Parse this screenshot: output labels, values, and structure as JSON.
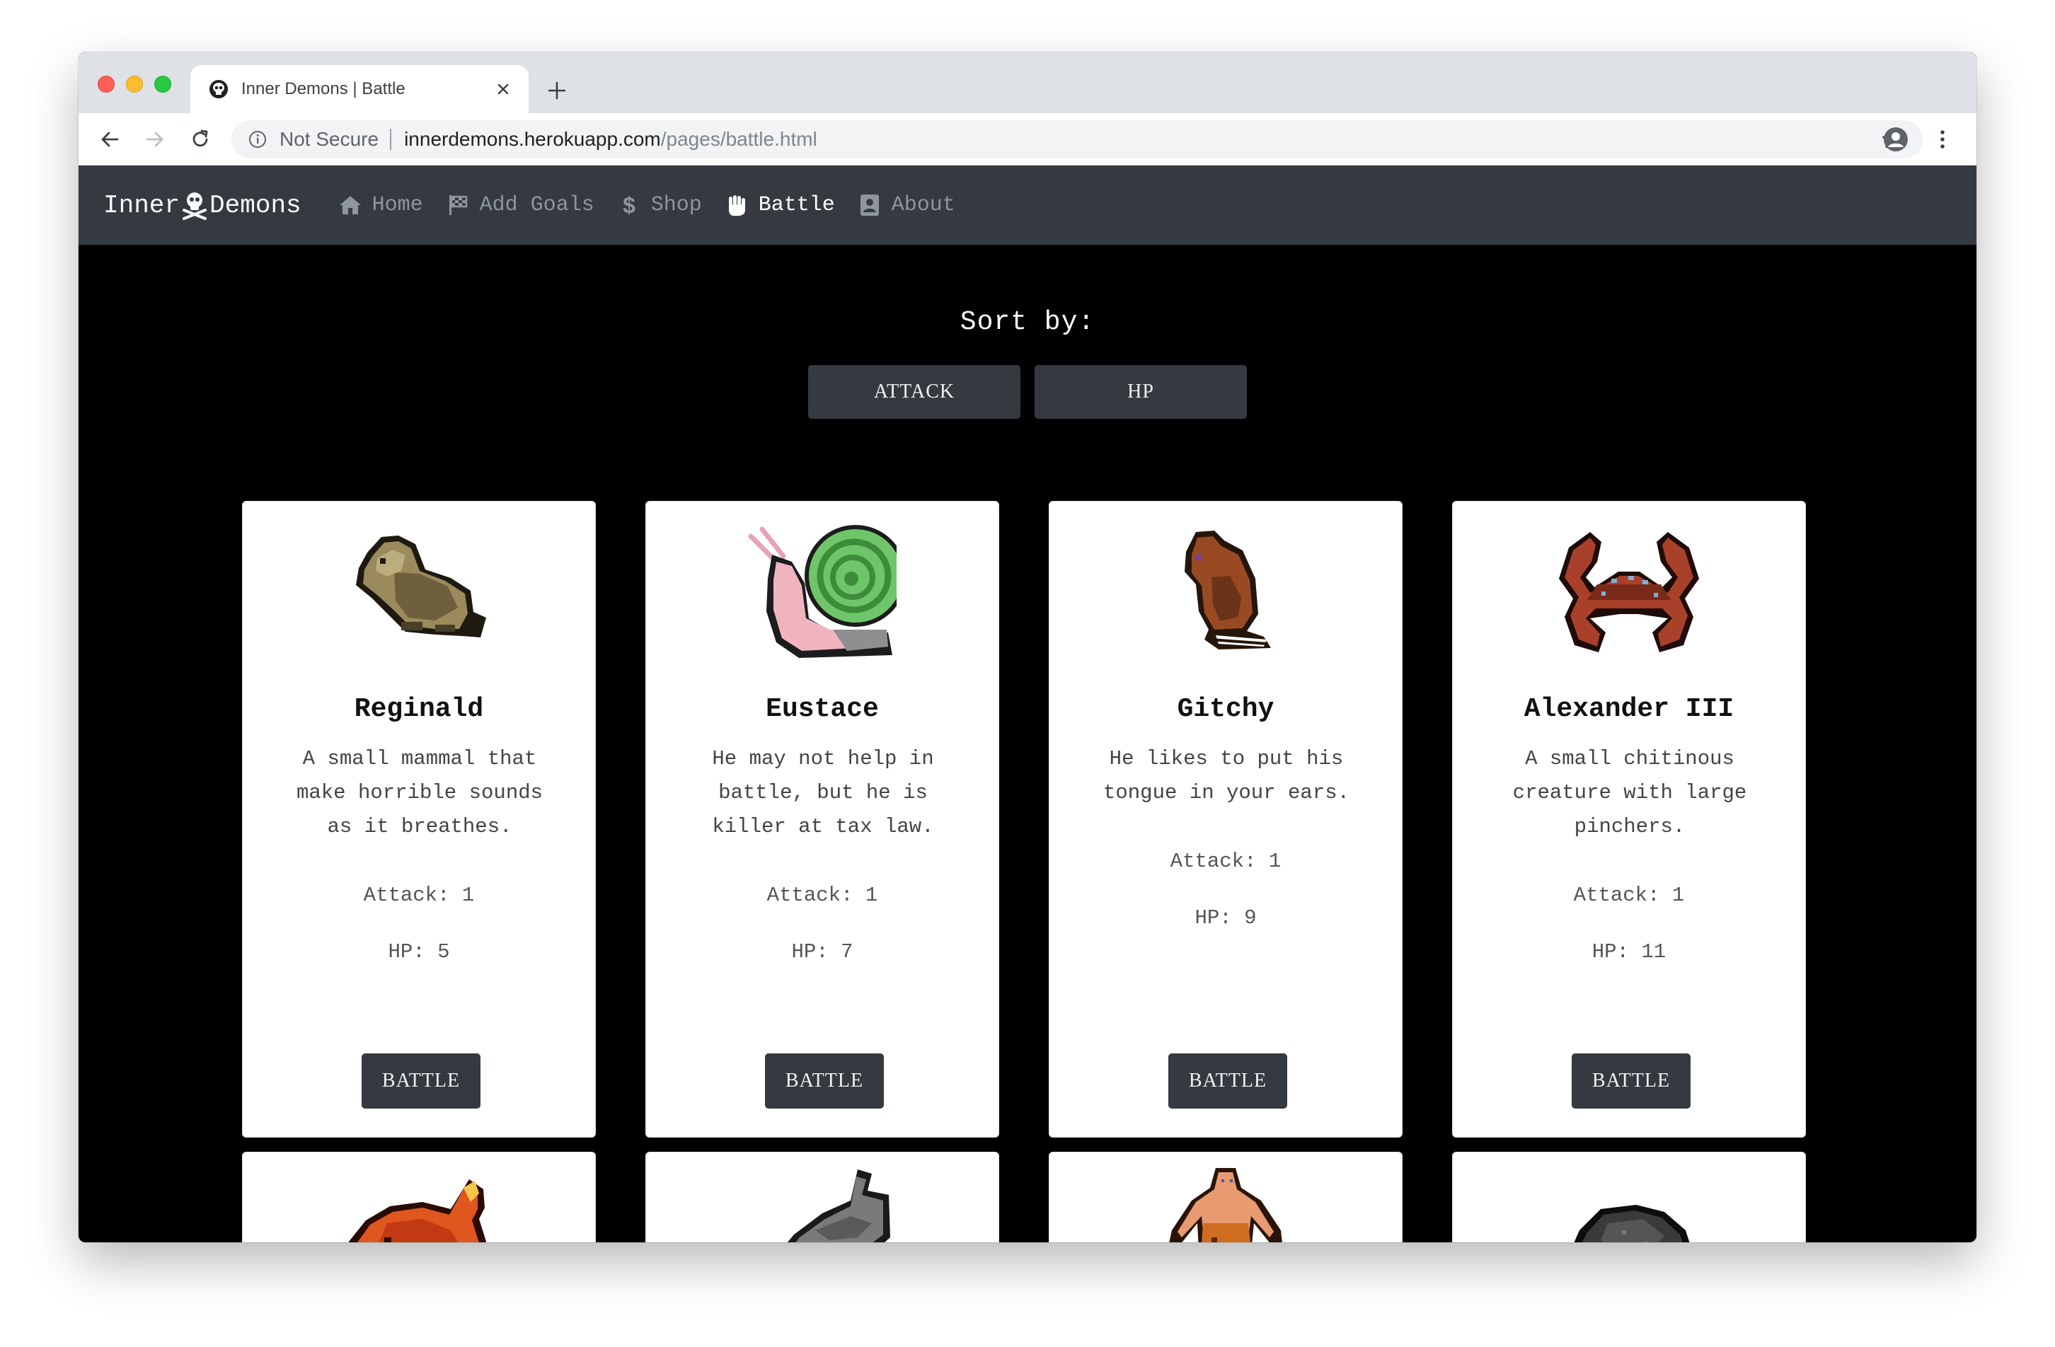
{
  "browser": {
    "tab_title": "Inner Demons | Battle",
    "security_label": "Not Secure",
    "url_host": "innerdemons.herokuapp.com",
    "url_path": "/pages/battle.html"
  },
  "site": {
    "brand_left": "Inner",
    "brand_right": "Demons",
    "nav": [
      {
        "label": "Home",
        "icon": "home-icon"
      },
      {
        "label": "Add Goals",
        "icon": "flag-icon"
      },
      {
        "label": "Shop",
        "icon": "dollar-icon"
      },
      {
        "label": "Battle",
        "icon": "fist-icon",
        "active": true
      },
      {
        "label": "About",
        "icon": "id-badge-icon"
      }
    ]
  },
  "sort": {
    "label": "Sort by:",
    "buttons": [
      "ATTACK",
      "HP"
    ]
  },
  "cards": [
    {
      "name": "Reginald",
      "description": "A small mammal that make horrible sounds as it breathes.",
      "attack": "Attack: 1",
      "hp": "HP: 5",
      "button": "BATTLE",
      "sprite": "gopher-sprite"
    },
    {
      "name": "Eustace",
      "description": "He may not help in battle, but he is killer at tax law.",
      "attack": "Attack: 1",
      "hp": "HP: 7",
      "button": "BATTLE",
      "sprite": "snail-sprite"
    },
    {
      "name": "Gitchy",
      "description": "He likes to put his tongue in your ears.",
      "attack": "Attack: 1",
      "hp": "HP: 9",
      "button": "BATTLE",
      "sprite": "rat-sprite"
    },
    {
      "name": "Alexander III",
      "description": "A small chitinous creature with large pinchers.",
      "attack": "Attack: 1",
      "hp": "HP: 11",
      "button": "BATTLE",
      "sprite": "crab-sprite"
    },
    {
      "sprite": "fire-pig-sprite"
    },
    {
      "sprite": "grey-wolf-sprite"
    },
    {
      "sprite": "caveman-sprite"
    },
    {
      "sprite": "black-bear-sprite"
    }
  ],
  "colors": {
    "navbar": "#343a40",
    "page_background": "#000000",
    "card_background": "#ffffff",
    "button": "#343a40"
  }
}
